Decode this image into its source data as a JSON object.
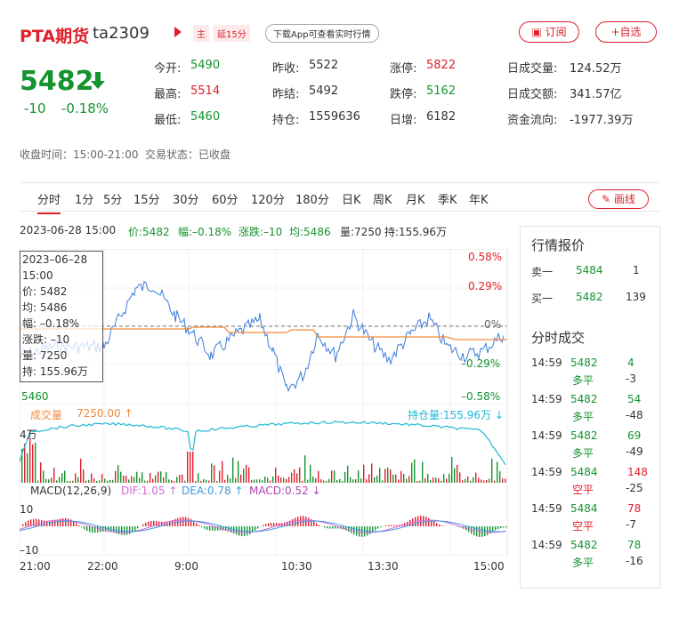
{
  "header": {
    "name": "PTA期货",
    "code": "ta2309",
    "tag_main": "主",
    "tag_delay": "延15分",
    "download": "下载App可查看实时行情",
    "subscribe": "订阅",
    "watchlist": "+自选"
  },
  "quote": {
    "price": "5482",
    "change": "-10",
    "change_pct": "-0.18%",
    "stats": [
      {
        "k": "今开:",
        "v": "5490",
        "c": "green"
      },
      {
        "k": "昨收:",
        "v": "5522",
        "c": "dark"
      },
      {
        "k": "涨停:",
        "v": "5822",
        "c": "red"
      },
      {
        "k": "日成交量:",
        "v": "124.52万",
        "c": "dark"
      },
      {
        "k": "最高:",
        "v": "5514",
        "c": "red"
      },
      {
        "k": "昨结:",
        "v": "5492",
        "c": "dark"
      },
      {
        "k": "跌停:",
        "v": "5162",
        "c": "green"
      },
      {
        "k": "日成交额:",
        "v": "341.57亿",
        "c": "dark"
      },
      {
        "k": "最低:",
        "v": "5460",
        "c": "green"
      },
      {
        "k": "持仓:",
        "v": "1559636",
        "c": "dark"
      },
      {
        "k": "日增:",
        "v": "6182",
        "c": "dark"
      },
      {
        "k": "资金流向:",
        "v": "-1977.39万",
        "c": "dark"
      }
    ],
    "close_time": "收盘时间：15:00-21:00",
    "trade_status": "交易状态：已收盘"
  },
  "tabs": [
    "分时",
    "1分",
    "5分",
    "15分",
    "30分",
    "60分",
    "120分",
    "180分",
    "日K",
    "周K",
    "月K",
    "季K",
    "年K"
  ],
  "draw_label": "画线",
  "status_bar": {
    "time": "2023-06-28 15:00",
    "price": "价:5482",
    "amp": "幅:–0.18%",
    "chg": "涨跌:–10",
    "avg": "均:5486",
    "vol": "量:7250",
    "oi": "持:155.96万"
  },
  "tooltip": {
    "date": "2023–06–28",
    "time": "15:00",
    "price": "价: 5482",
    "avg": "均: 5486",
    "amp": "幅: –0.18%",
    "chg": "涨跌: –10",
    "vol": "量: 7250",
    "oi": "持: 155.96万"
  },
  "chart_axes": {
    "pct_top": "0.58%",
    "pct_mid_top": "0.29%",
    "pct_zero": "0%",
    "pct_mid_bottom": "–0.29%",
    "pct_bottom": "–0.58%",
    "price_bottom": "5460",
    "vol_label": "成交量",
    "vol_value": "7250.00",
    "oi_label": "持仓量:155.96万",
    "vol_scale": "4万",
    "macd_title": "MACD(12,26,9)",
    "dif": "DIF:1.05",
    "dea": "DEA:0.78",
    "macd": "MACD:0.52",
    "macd_top": "10",
    "macd_bottom": "–10",
    "x_labels": [
      "21:00",
      "22:00",
      "9:00",
      "10:30",
      "13:30",
      "15:00"
    ]
  },
  "panel": {
    "quote_title": "行情报价",
    "sell": {
      "label": "卖一",
      "price": "5484",
      "vol": "1"
    },
    "buy": {
      "label": "买一",
      "price": "5482",
      "vol": "139"
    },
    "trades_title": "分时成交",
    "trades": [
      {
        "time": "14:59",
        "price": "5482",
        "pc": "green",
        "vol": "4",
        "vc": "green",
        "type": "多平",
        "tc": "green",
        "diff": "-3"
      },
      {
        "time": "14:59",
        "price": "5482",
        "pc": "green",
        "vol": "54",
        "vc": "green",
        "type": "多平",
        "tc": "green",
        "diff": "-48"
      },
      {
        "time": "14:59",
        "price": "5482",
        "pc": "green",
        "vol": "69",
        "vc": "green",
        "type": "多平",
        "tc": "green",
        "diff": "-49"
      },
      {
        "time": "14:59",
        "price": "5484",
        "pc": "green",
        "vol": "148",
        "vc": "red",
        "type": "空平",
        "tc": "red",
        "diff": "-25"
      },
      {
        "time": "14:59",
        "price": "5484",
        "pc": "green",
        "vol": "78",
        "vc": "red",
        "type": "空平",
        "tc": "red",
        "diff": "-7"
      },
      {
        "time": "14:59",
        "price": "5482",
        "pc": "green",
        "vol": "78",
        "vc": "green",
        "type": "多平",
        "tc": "green",
        "diff": "-16"
      }
    ]
  },
  "colors": {
    "up": "#e0202b",
    "down": "#14932f",
    "price_line": "#3b7ddd",
    "avg_line": "#f08a3c",
    "oi_line": "#1cb8d8"
  }
}
